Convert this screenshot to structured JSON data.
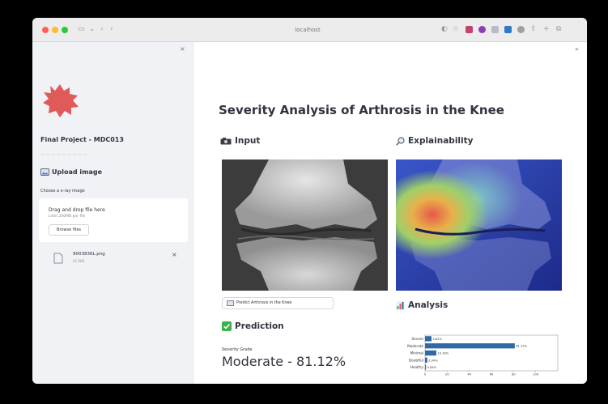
{
  "browser": {
    "url": "localhost"
  },
  "sidebar": {
    "title": "Final Project - MDC013",
    "subtitle": "— — — — — — — — —",
    "upload_header": "Upload image",
    "choose_label": "Choose a x-ray image",
    "dropzone_title": "Drag and drop file here",
    "dropzone_limit": "Limit 200MB per file",
    "browse_label": "Browse files",
    "file_name": "9003836L.png",
    "file_size": "65.9KB",
    "remove_label": "×",
    "collapse_label": "×"
  },
  "main": {
    "collapse_label": "»",
    "title": "Severity Analysis of Arthrosis in the Knee",
    "input_header": "Input",
    "explain_header": "Explainability",
    "predict_button": "Predict Arthrosis in the Knee",
    "prediction_header": "Prediction",
    "severity_label": "Severity Grade",
    "severity_value": "Moderate - 81.12%",
    "analysis_header": "Analysis"
  },
  "chart_data": {
    "type": "bar",
    "orientation": "horizontal",
    "categories": [
      "Severe",
      "Moderate",
      "Minimal",
      "Doubtful",
      "Healthy"
    ],
    "values": [
      5.82,
      81.12,
      10.18,
      2.04,
      0.84
    ],
    "data_labels": [
      "5.82%",
      "81.12%",
      "10.18%",
      "2.04%",
      "0.84%"
    ],
    "xlim": [
      0,
      120
    ],
    "xticks": [
      0,
      20,
      40,
      60,
      80,
      100
    ],
    "color": "#2f6aa6",
    "grid": false
  },
  "colors": {
    "logo": "#e05a5a",
    "bar": "#2f6aa6",
    "traffic_red": "#ff5f57",
    "traffic_yellow": "#febc2e",
    "traffic_green": "#28c840"
  }
}
